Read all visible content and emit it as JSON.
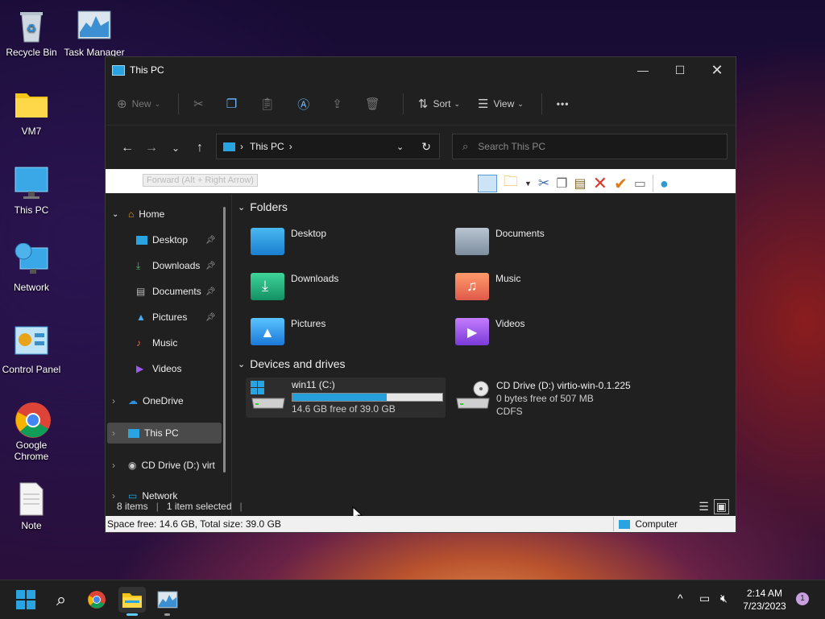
{
  "desktop": {
    "icons": [
      {
        "label": "Recycle Bin"
      },
      {
        "label": "Task Manager"
      },
      {
        "label": "VM7"
      },
      {
        "label": "This PC"
      },
      {
        "label": "Network"
      },
      {
        "label": "Control Panel"
      },
      {
        "label": "Google Chrome"
      },
      {
        "label": "Note"
      }
    ]
  },
  "window": {
    "title": "This PC",
    "commands": {
      "new": "New",
      "sort": "Sort",
      "view": "View",
      "more": "•••"
    },
    "address": {
      "path": "This PC"
    },
    "search": {
      "placeholder": "Search This PC"
    },
    "tooltip": "Forward (Alt + Right Arrow)",
    "sidebar": {
      "items": [
        {
          "label": "Home"
        },
        {
          "label": "Desktop"
        },
        {
          "label": "Downloads"
        },
        {
          "label": "Documents"
        },
        {
          "label": "Pictures"
        },
        {
          "label": "Music"
        },
        {
          "label": "Videos"
        },
        {
          "label": "OneDrive"
        },
        {
          "label": "This PC"
        },
        {
          "label": "CD Drive (D:) virt"
        },
        {
          "label": "Network"
        }
      ]
    },
    "folders_header": "Folders",
    "folders": [
      {
        "label": "Desktop"
      },
      {
        "label": "Documents"
      },
      {
        "label": "Downloads"
      },
      {
        "label": "Music"
      },
      {
        "label": "Pictures"
      },
      {
        "label": "Videos"
      }
    ],
    "drives_header": "Devices and drives",
    "drives": [
      {
        "name": "win11 (C:)",
        "free": "14.6 GB free of 39.0 GB",
        "used_fraction": 0.63
      },
      {
        "name": "CD Drive (D:) virtio-win-0.1.225",
        "free": "0 bytes free of 507 MB",
        "fs": "CDFS"
      }
    ],
    "status": {
      "items": "8 items",
      "selected": "1 item selected"
    },
    "statusbar": {
      "space": "Space free: 14.6 GB, Total size: 39.0 GB",
      "location": "Computer"
    }
  },
  "taskbar": {
    "time": "2:14 AM",
    "date": "7/23/2023",
    "notification_count": "1"
  }
}
